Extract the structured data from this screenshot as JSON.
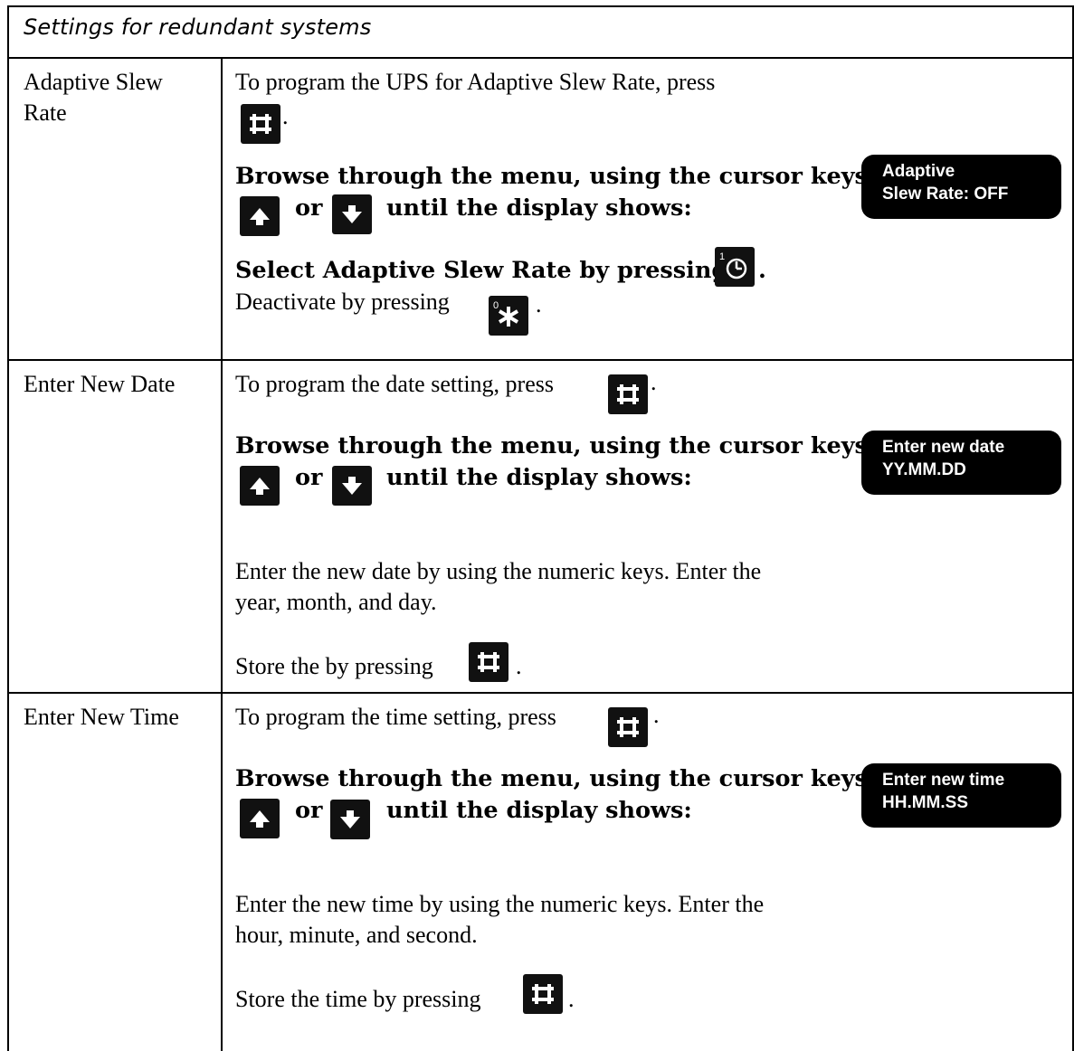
{
  "title": "Settings for redundant systems",
  "rows": [
    {
      "label": "Adaptive Slew Rate",
      "label_line1": "Adaptive Slew",
      "label_line2": "Rate",
      "intro": "To program the UPS for Adaptive Slew Rate, press",
      "browse": "Browse through the menu, using the cursor keys",
      "or": "or",
      "until": "until the display shows:",
      "select": "Select Adaptive Slew Rate by pressing",
      "deactivate": "Deactivate by pressing",
      "display_line1": "Adaptive",
      "display_line2": "Slew Rate: OFF"
    },
    {
      "label": "Enter New Date",
      "intro": "To program the date setting, press",
      "browse": "Browse through the menu, using the cursor keys",
      "or": "or",
      "until": "until the display shows:",
      "enter_line1": "Enter the new date by using the numeric keys. Enter the",
      "enter_line2": "year, month, and day.",
      "store": "Store the by pressing",
      "display_line1": "Enter new date",
      "display_line2": "YY.MM.DD"
    },
    {
      "label": "Enter New Time",
      "intro": "To program the time setting, press",
      "browse": "Browse through the menu, using the cursor keys",
      "or": "or",
      "until": "until the display shows:",
      "enter_line1": "Enter the new time by using the numeric keys. Enter the",
      "enter_line2": "hour, minute, and second.",
      "store": "Store the time by pressing",
      "display_line1": "Enter new time",
      "display_line2": "HH.MM.SS"
    }
  ],
  "keys": {
    "enter": "hash-key-icon",
    "up": "arrow-up-key-icon",
    "down": "arrow-down-key-icon",
    "one": "key-1-clock-icon",
    "zero": "key-0-star-icon"
  },
  "key_digits": {
    "one": "1",
    "zero": "0"
  },
  "punct": "."
}
